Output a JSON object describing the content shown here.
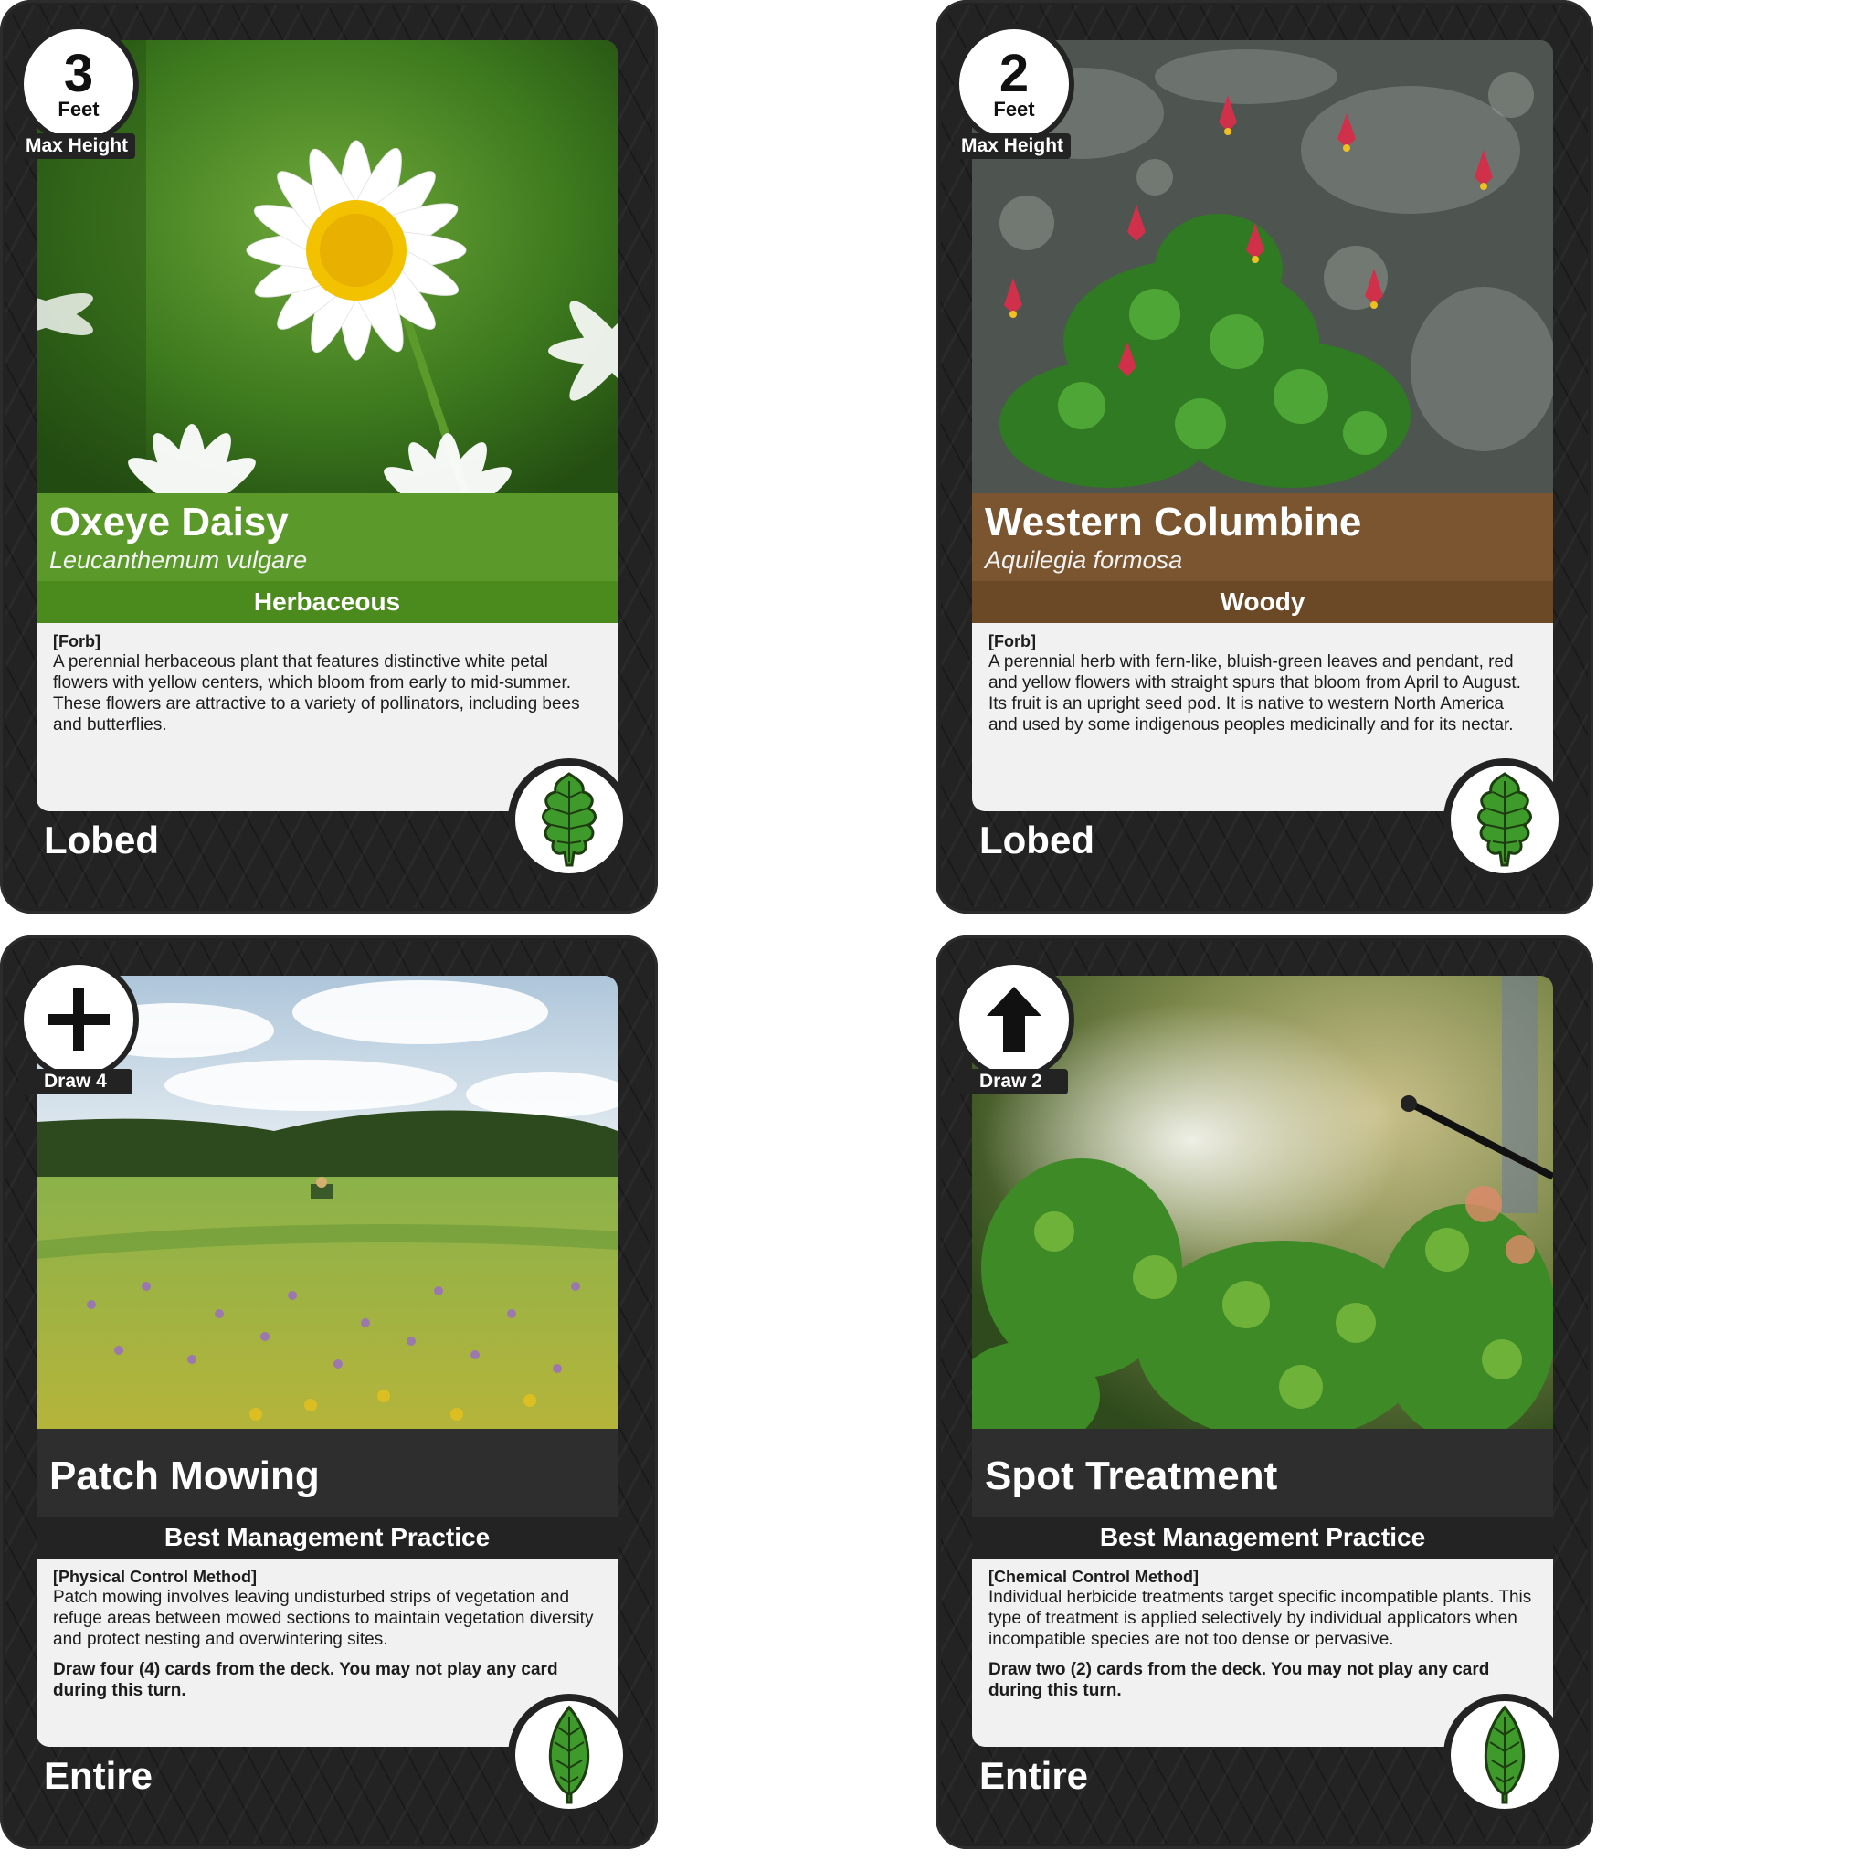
{
  "cards": [
    {
      "corner_value": "3",
      "corner_unit": "Feet",
      "corner_label": "Max Height",
      "title": "Oxeye Daisy",
      "latin": "Leucanthemum vulgare",
      "type": "Herbaceous",
      "category": "[Forb]",
      "description": "A perennial herbaceous plant that features distinctive white petal flowers with yellow centers, which bloom from early to mid-summer. These flowers are attractive to a variety of pollinators, including bees and butterflies.",
      "action": "",
      "leaf_type": "Lobed",
      "leaf_icon": "lobed-leaf-icon",
      "band_color": "#5b9a2a",
      "type_color": "#4b8a1c"
    },
    {
      "corner_value": "2",
      "corner_unit": "Feet",
      "corner_label": "Max Height",
      "title": "Western Columbine",
      "latin": "Aquilegia formosa",
      "type": "Woody",
      "category": "[Forb]",
      "description": "A perennial herb with fern-like, bluish-green leaves and pendant, red and yellow flowers with straight spurs that bloom from April to August. Its fruit is an upright seed pod. It is native to western North America and used by some indigenous peoples medicinally and for its nectar.",
      "action": "",
      "leaf_type": "Lobed",
      "leaf_icon": "lobed-leaf-icon",
      "band_color": "#7a5530",
      "type_color": "#6b4826"
    },
    {
      "corner_icon": "plus-icon",
      "corner_label": "Draw 4",
      "title": "Patch Mowing",
      "latin": "",
      "type": "Best Management Practice",
      "category": "[Physical Control Method]",
      "description": "Patch mowing involves leaving undisturbed strips of vegetation and refuge areas between mowed sections to maintain vegetation diversity and protect nesting and overwintering sites.",
      "action": "Draw four (4) cards from the deck. You may not play any card during this turn.",
      "leaf_type": "Entire",
      "leaf_icon": "entire-leaf-icon",
      "band_color": "#2e2e2e",
      "type_color": "#232323"
    },
    {
      "corner_icon": "up-arrow-icon",
      "corner_label": "Draw 2",
      "title": "Spot Treatment",
      "latin": "",
      "type": "Best Management Practice",
      "category": "[Chemical Control Method]",
      "description": "Individual herbicide treatments target specific incompatible plants. This type of treatment is applied selectively by individual applicators when incompatible species are not too dense or pervasive.",
      "action": "Draw two (2) cards from the deck. You may not play any card during this turn.",
      "leaf_type": "Entire",
      "leaf_icon": "entire-leaf-icon",
      "band_color": "#2e2e2e",
      "type_color": "#232323"
    }
  ]
}
